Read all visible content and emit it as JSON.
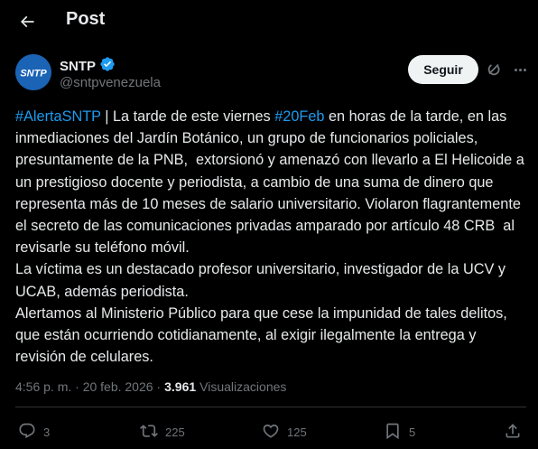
{
  "header": {
    "title": "Post"
  },
  "author": {
    "name": "SNTP",
    "handle": "@sntpvenezuela",
    "avatar_text": "SNTP",
    "verified": true
  },
  "follow_label": "Seguir",
  "post": {
    "segments": [
      {
        "text": "#AlertaSNTP",
        "hashtag": true
      },
      {
        "text": " | La tarde de este viernes ",
        "hashtag": false
      },
      {
        "text": "#20Feb",
        "hashtag": true
      },
      {
        "text": " en horas de la tarde, en las inmediaciones del Jardín Botánico, un grupo de funcionarios policiales, presuntamente de la PNB,  extorsionó y amenazó con llevarlo a El Helicoide a un prestigioso docente y periodista, a cambio de una suma de dinero que representa más de 10 meses de salario universitario. Violaron flagrantemente el secreto de las comunicaciones privadas amparado por artículo 48 CRB  al revisarle su teléfono móvil.\nLa víctima es un destacado profesor universitario, investigador de la UCV y UCAB, además periodista.\nAlertamos al Ministerio Público para que cese la impunidad de tales delitos, que están ocurriendo cotidianamente, al exigir ilegalmente la entrega y revisión de celulares.",
        "hashtag": false
      }
    ]
  },
  "meta": {
    "time": "4:56 p. m. · 20 feb. 2026 · ",
    "views_count": "3.961",
    "views_label": "Visualizaciones"
  },
  "actions": {
    "replies": "3",
    "reposts": "225",
    "likes": "125",
    "bookmarks": "5"
  },
  "colors": {
    "accent": "#1d9bf0",
    "background": "#000000",
    "text": "#e7e9ea",
    "muted": "#71767b"
  }
}
